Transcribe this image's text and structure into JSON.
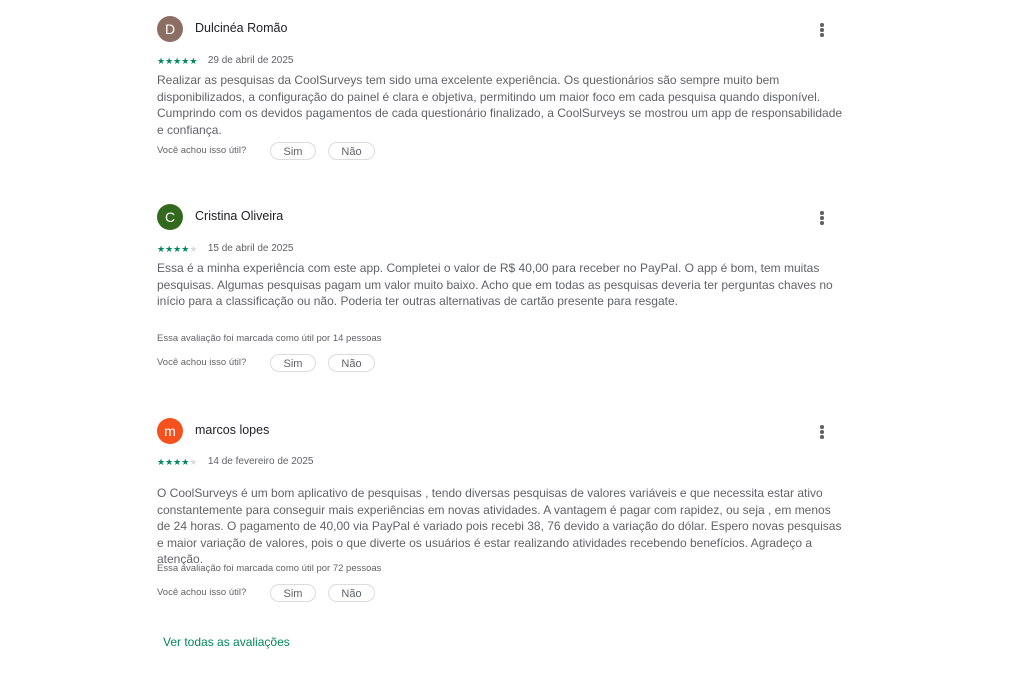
{
  "reviews": [
    {
      "initial": "D",
      "avatar_color": "#8d6e63",
      "author": "Dulcinéa Romão",
      "rating": 5,
      "max_rating": 5,
      "date": "29 de abril de 2025",
      "text": "Realizar as pesquisas da CoolSurveys tem sido uma excelente experiência. Os questionários são sempre muito bem disponibilizados, a configuração do painel é clara e objetiva, permitindo um maior foco em cada pesquisa quando disponível. Cumprindo com os devidos pagamentos de cada questionário finalizado, a CoolSurveys se mostrou um app de responsabilidade e confiança.",
      "helpful_count_text": "",
      "helpful_question": "Você achou isso útil?",
      "yes_label": "Sim",
      "no_label": "Não"
    },
    {
      "initial": "C",
      "avatar_color": "#33691e",
      "author": "Cristina Oliveira",
      "rating": 4,
      "max_rating": 5,
      "date": "15 de abril de 2025",
      "text": "Essa é a minha experiência com este app. Completei o valor de R$ 40,00 para receber no PayPal. O app é bom, tem muitas pesquisas. Algumas pesquisas pagam um valor muito baixo. Acho que em todas as pesquisas deveria ter perguntas chaves no início para a classificação ou não. Poderia ter outras alternativas de cartão presente para resgate.",
      "helpful_count_text": "Essa avaliação foi marcada como útil por 14 pessoas",
      "helpful_question": "Você achou isso útil?",
      "yes_label": "Sim",
      "no_label": "Não"
    },
    {
      "initial": "m",
      "avatar_color": "#f4511e",
      "author": "marcos lopes",
      "rating": 4,
      "max_rating": 5,
      "date": "14 de fevereiro de 2025",
      "text": "O CoolSurveys é um bom aplicativo de pesquisas , tendo diversas pesquisas de valores variáveis e que necessita estar ativo constantemente para conseguir mais experiências em novas atividades. A vantagem é pagar com rapidez, ou seja , em menos de 24 horas. O pagamento de 40,00 via PayPal é variado pois recebi 38, 76 devido a variação do dólar. Espero novas pesquisas e maior variação de valores, pois o que diverte os usuários é estar realizando atividades recebendo benefícios. Agradeço a atenção.",
      "helpful_count_text": "Essa avaliação foi marcada como útil por 72 pessoas",
      "helpful_question": "Você achou isso útil?",
      "yes_label": "Sim",
      "no_label": "Não"
    }
  ],
  "see_all_label": "Ver todas as avaliações",
  "colors": {
    "accent": "#01875f",
    "star_empty": "#dadce0",
    "secondary_text": "#5f6368"
  },
  "icons": {
    "more": "more-vert-icon",
    "star": "star-icon"
  }
}
